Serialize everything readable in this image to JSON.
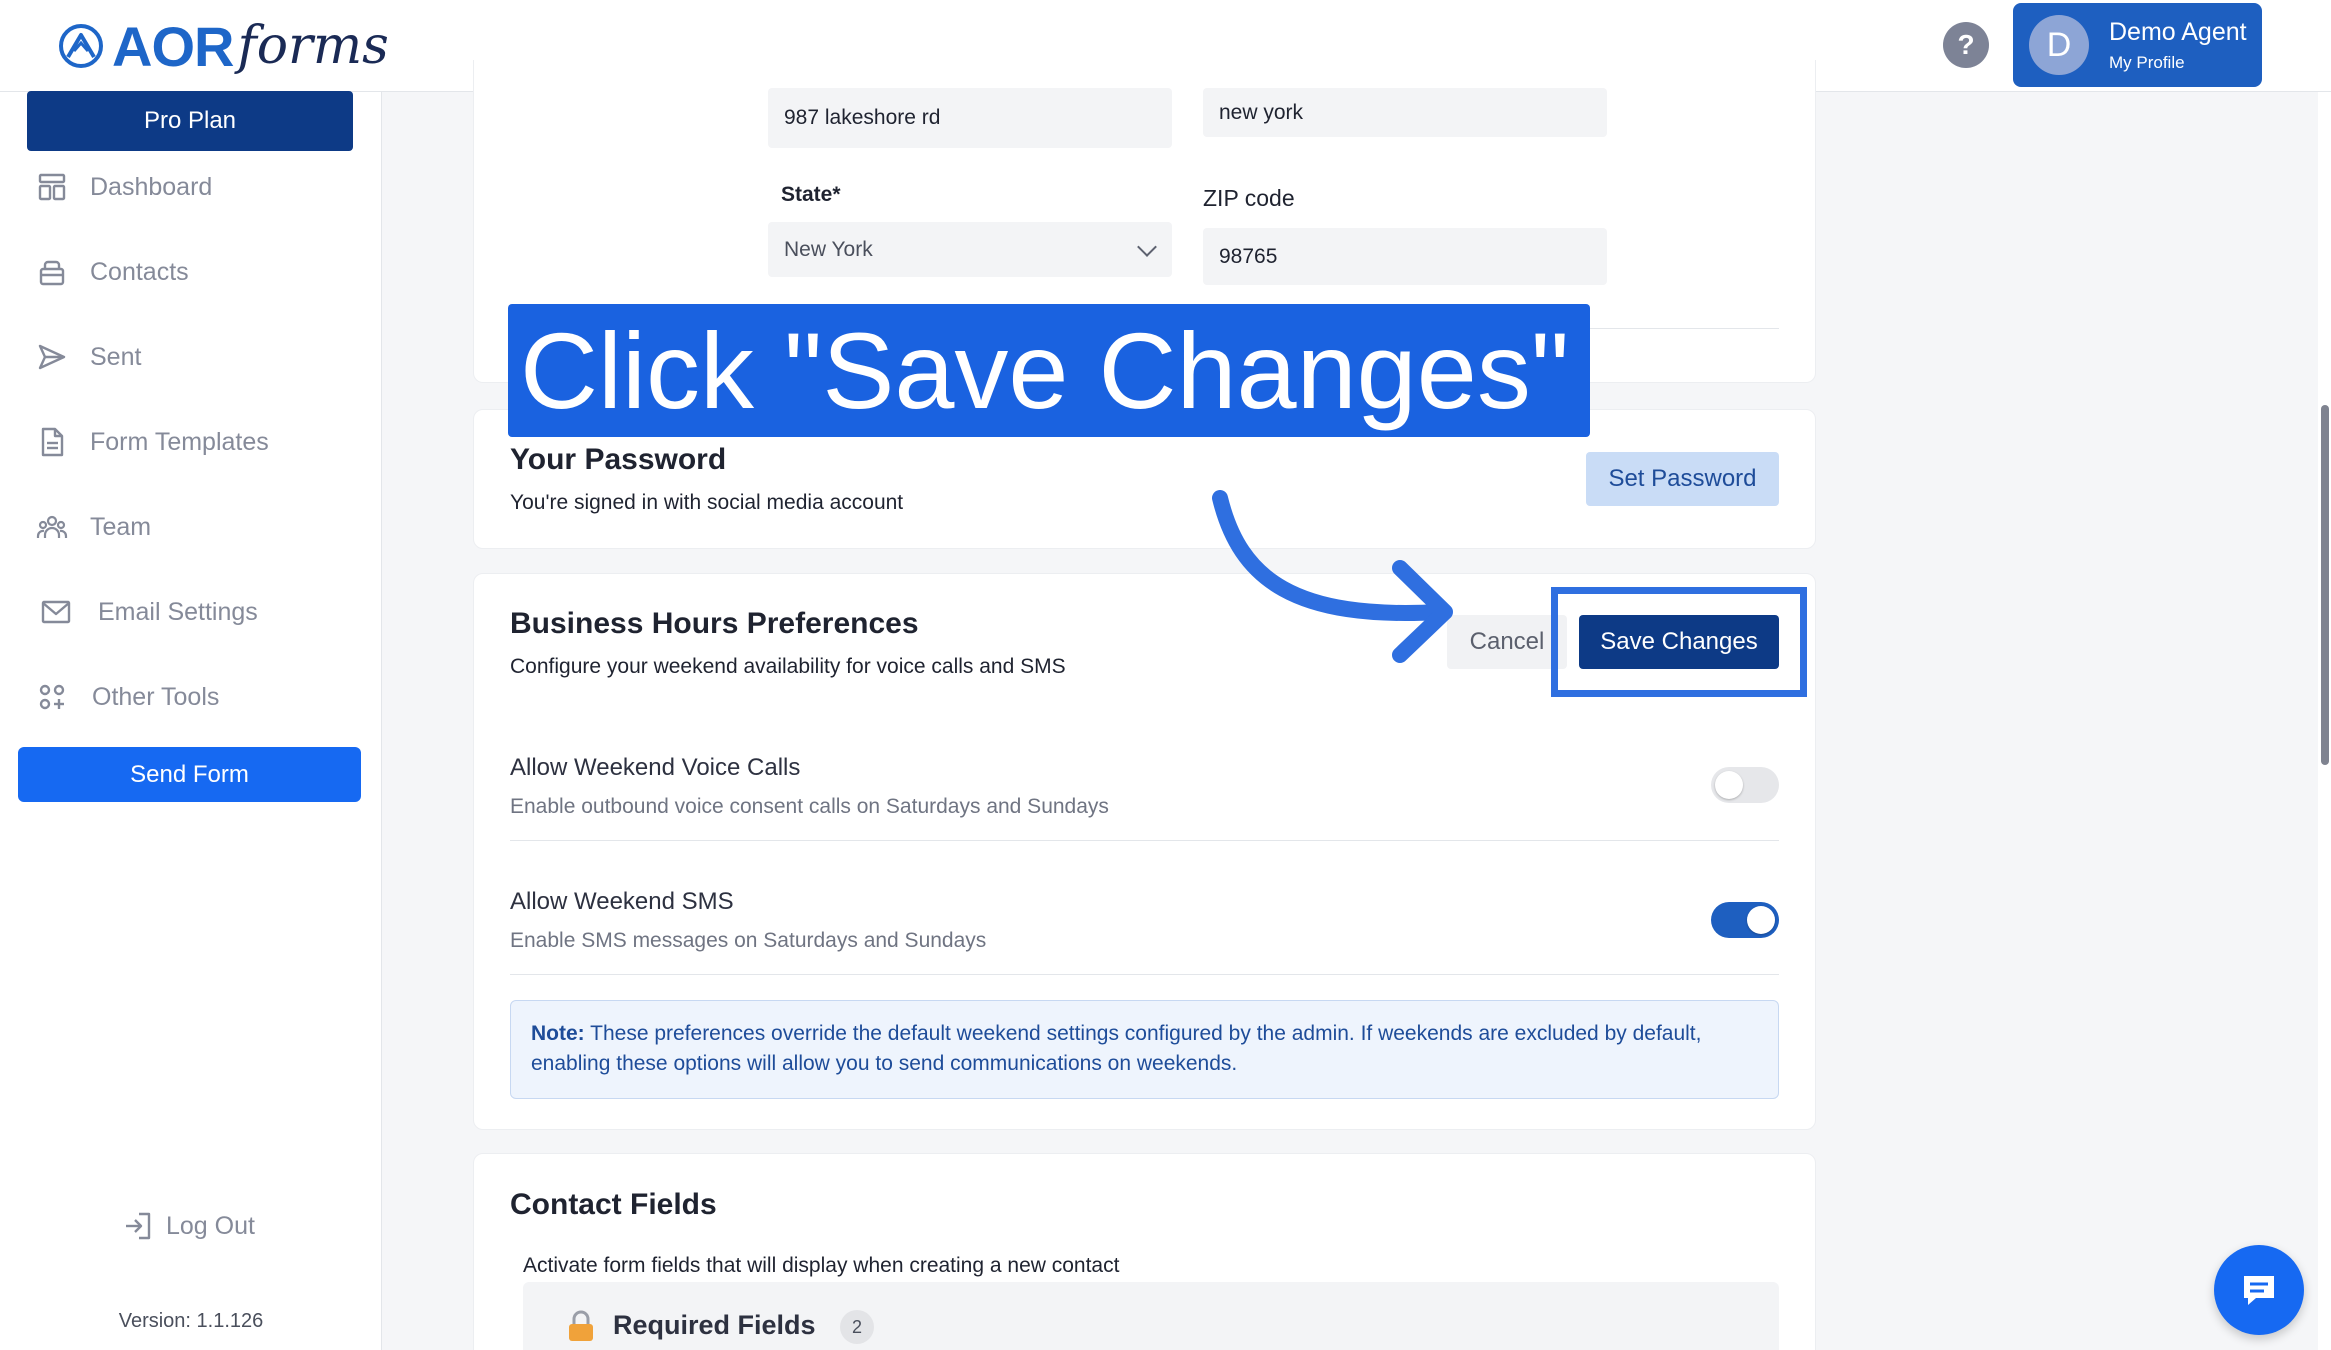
{
  "header": {
    "logo_text": "AOR",
    "logo_script": "forms",
    "help_label": "?",
    "profile": {
      "initial": "D",
      "name": "Demo Agent",
      "link": "My Profile"
    }
  },
  "sidebar": {
    "plan": "Pro Plan",
    "items": [
      {
        "label": "Dashboard",
        "icon": "dashboard-icon"
      },
      {
        "label": "Contacts",
        "icon": "contacts-icon"
      },
      {
        "label": "Sent",
        "icon": "send-icon"
      },
      {
        "label": "Form Templates",
        "icon": "document-icon"
      },
      {
        "label": "Team",
        "icon": "team-icon"
      },
      {
        "label": "Email Settings",
        "icon": "mail-icon"
      },
      {
        "label": "Other Tools",
        "icon": "grid-plus-icon"
      }
    ],
    "send_form": "Send Form",
    "logout": "Log Out",
    "version": "Version: 1.1.126"
  },
  "address": {
    "street_value": "987 lakeshore rd",
    "city_value": "new york",
    "state_label": "State*",
    "state_value": "New York",
    "zip_label": "ZIP code",
    "zip_value": "98765"
  },
  "callout": {
    "text": "Click \"Save Changes\""
  },
  "password": {
    "title": "Your Password",
    "desc": "You're signed in with social media account",
    "button": "Set Password"
  },
  "business_hours": {
    "title": "Business Hours Preferences",
    "desc": "Configure your weekend availability for voice calls and SMS",
    "cancel": "Cancel",
    "save": "Save Changes",
    "voice": {
      "title": "Allow Weekend Voice Calls",
      "desc": "Enable outbound voice consent calls on Saturdays and Sundays",
      "enabled": false
    },
    "sms": {
      "title": "Allow Weekend SMS",
      "desc": "Enable SMS messages on Saturdays and Sundays",
      "enabled": true
    },
    "note_label": "Note:",
    "note_text": " These preferences override the default weekend settings configured by the admin. If weekends are excluded by default, enabling these options will allow you to send communications on weekends."
  },
  "contact_fields": {
    "title": "Contact Fields",
    "desc": "Activate form fields that will display when creating a new contact",
    "required_label": "Required Fields",
    "required_count": "2"
  },
  "colors": {
    "brand_blue": "#1669f2",
    "navy": "#0d3a86",
    "callout_blue": "#1a62e0",
    "highlight_border": "#2f6fe0"
  }
}
